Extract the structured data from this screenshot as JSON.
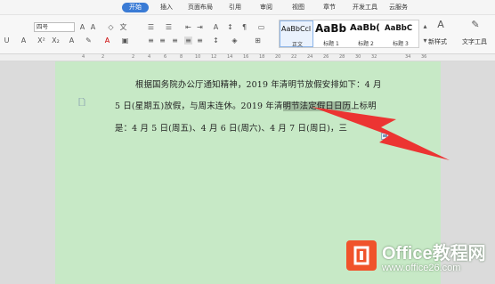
{
  "tabs": [
    {
      "label": "开始",
      "active": true
    },
    {
      "label": "插入"
    },
    {
      "label": "页面布局"
    },
    {
      "label": "引用"
    },
    {
      "label": "审阅"
    },
    {
      "label": "视图"
    },
    {
      "label": "章节"
    },
    {
      "label": "开发工具"
    },
    {
      "label": "云服务"
    }
  ],
  "ribbon": {
    "font_size": "四号",
    "styles": [
      {
        "sample": "AaBbCcl",
        "name": "正文"
      },
      {
        "sample": "AaBb",
        "name": "标题 1"
      },
      {
        "sample": "AaBb(",
        "name": "标题 2"
      },
      {
        "sample": "AaBbC",
        "name": "标题 3"
      }
    ],
    "new_style": "新样式",
    "text_tools": "文字工具"
  },
  "ruler": [
    "4",
    "2",
    "2",
    "4",
    "6",
    "8",
    "10",
    "12",
    "14",
    "16",
    "18",
    "20",
    "22",
    "24",
    "26",
    "28",
    "30",
    "32",
    "34",
    "36"
  ],
  "document": {
    "line1": "根据国务院办公厅通知精神，2019 年清明节放假安排如下：4 月",
    "line2_before": "5 日(星期五)放假，与周末连休。2019 年清",
    "line2_highlight": "明节法定假日日历",
    "line2_after": "上标明",
    "line3": "是：4 月 5 日(周五)、4 月 6 日(周六)、4 月 7 日(周日)，三"
  },
  "logo": {
    "title": "Office教程网",
    "url": "www.office26.com"
  },
  "colors": {
    "accent": "#3a7bd5",
    "page_bg": "#c7e9c6",
    "arrow": "#ee2a2a",
    "logo": "#f0532b"
  }
}
